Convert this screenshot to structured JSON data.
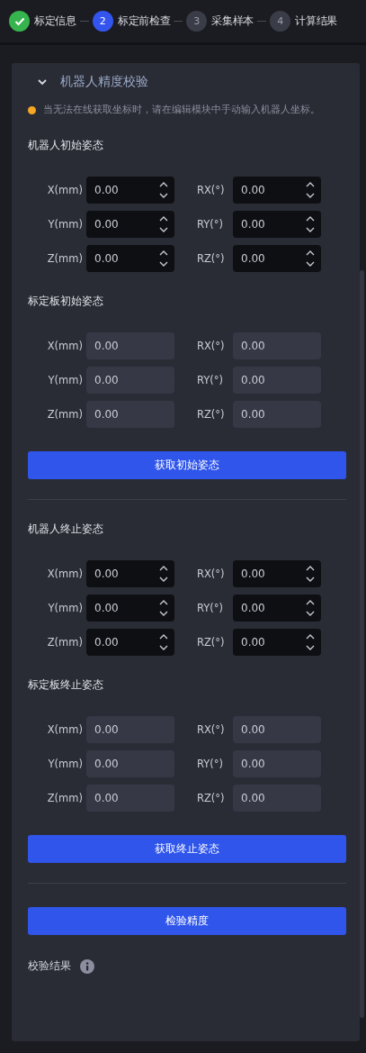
{
  "steps": [
    {
      "label": "标定信息",
      "done": true,
      "selected": false
    },
    {
      "number": "2",
      "label": "标定前检查",
      "done": false,
      "selected": true
    },
    {
      "number": "3",
      "label": "采集样本",
      "done": false,
      "selected": false
    },
    {
      "number": "4",
      "label": "计算结果",
      "done": false,
      "selected": false
    }
  ],
  "panel": {
    "title": "机器人精度校验",
    "expanded": true,
    "warning": "当无法在线获取坐标时，请在编辑模块中手动输入机器人坐标。",
    "blocks": [
      {
        "kind": "pose",
        "title": "机器人初始姿态",
        "editable": true,
        "rows": [
          [
            {
              "label": "X(mm)",
              "value": "0.00"
            },
            {
              "label": "RX(°)",
              "value": "0.00"
            }
          ],
          [
            {
              "label": "Y(mm)",
              "value": "0.00"
            },
            {
              "label": "RY(°)",
              "value": "0.00"
            }
          ],
          [
            {
              "label": "Z(mm)",
              "value": "0.00"
            },
            {
              "label": "RZ(°)",
              "value": "0.00"
            }
          ]
        ]
      },
      {
        "kind": "pose",
        "title": "标定板初始姿态",
        "editable": false,
        "rows": [
          [
            {
              "label": "X(mm)",
              "value": "0.00"
            },
            {
              "label": "RX(°)",
              "value": "0.00"
            }
          ],
          [
            {
              "label": "Y(mm)",
              "value": "0.00"
            },
            {
              "label": "RY(°)",
              "value": "0.00"
            }
          ],
          [
            {
              "label": "Z(mm)",
              "value": "0.00"
            },
            {
              "label": "RZ(°)",
              "value": "0.00"
            }
          ]
        ]
      },
      {
        "kind": "button",
        "label": "获取初始姿态"
      },
      {
        "kind": "divider"
      },
      {
        "kind": "pose",
        "title": "机器人终止姿态",
        "editable": true,
        "rows": [
          [
            {
              "label": "X(mm)",
              "value": "0.00"
            },
            {
              "label": "RX(°)",
              "value": "0.00"
            }
          ],
          [
            {
              "label": "Y(mm)",
              "value": "0.00"
            },
            {
              "label": "RY(°)",
              "value": "0.00"
            }
          ],
          [
            {
              "label": "Z(mm)",
              "value": "0.00"
            },
            {
              "label": "RZ(°)",
              "value": "0.00"
            }
          ]
        ]
      },
      {
        "kind": "pose",
        "title": "标定板终止姿态",
        "editable": false,
        "rows": [
          [
            {
              "label": "X(mm)",
              "value": "0.00"
            },
            {
              "label": "RX(°)",
              "value": "0.00"
            }
          ],
          [
            {
              "label": "Y(mm)",
              "value": "0.00"
            },
            {
              "label": "RY(°)",
              "value": "0.00"
            }
          ],
          [
            {
              "label": "Z(mm)",
              "value": "0.00"
            },
            {
              "label": "RZ(°)",
              "value": "0.00"
            }
          ]
        ]
      },
      {
        "kind": "button",
        "label": "获取终止姿态"
      },
      {
        "kind": "divider"
      },
      {
        "kind": "button",
        "label": "检验精度"
      },
      {
        "kind": "result",
        "label": "校验结果"
      }
    ]
  }
}
